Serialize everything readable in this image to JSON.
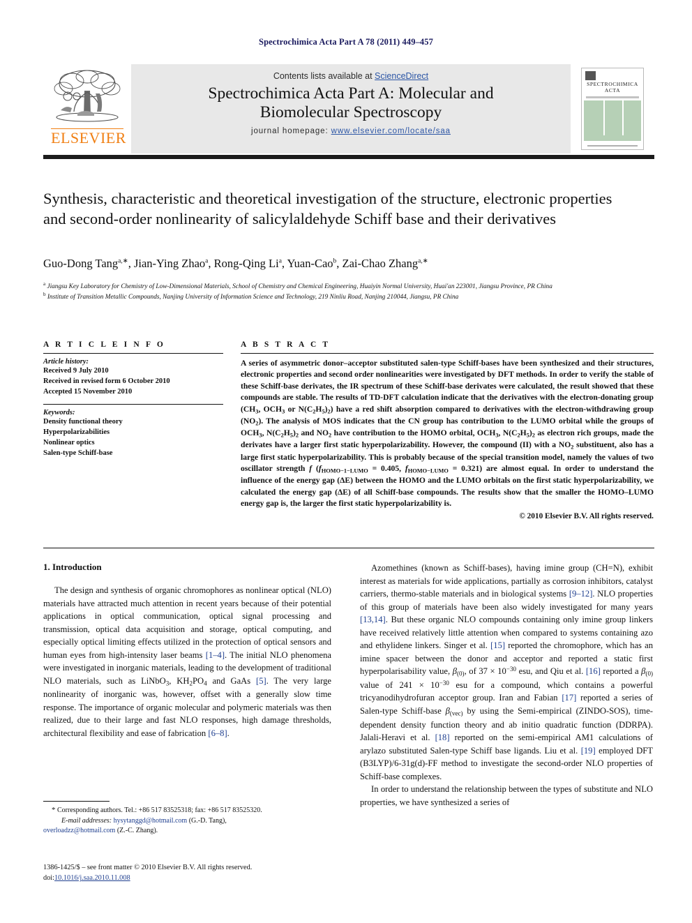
{
  "running_head": "Spectrochimica Acta Part A 78 (2011) 449–457",
  "masthead": {
    "contents_prefix": "Contents lists available at ",
    "sciencedirect": "ScienceDirect",
    "journal_name_line1": "Spectrochimica Acta Part A: Molecular and",
    "journal_name_line2": "Biomolecular Spectroscopy",
    "homepage_prefix": "journal homepage: ",
    "homepage_url": "www.elsevier.com/locate/saa",
    "publisher_logo_text": "ELSEVIER",
    "cover_title_line1": "SPECTROCHIMICA",
    "cover_title_line2": "ACTA"
  },
  "article": {
    "title": "Synthesis, characteristic and theoretical investigation of the structure, electronic properties and second-order nonlinearity of salicylaldehyde Schiff base and their derivatives",
    "authors_html": "Guo-Dong Tang<sup>a,∗</sup>, Jian-Ying Zhao<sup>a</sup>, Rong-Qing Li<sup>a</sup>, Yuan-Cao<sup>b</sup>, Zai-Chao Zhang<sup>a,∗</sup>",
    "affiliation_a": "Jiangsu Key Laboratory for Chemistry of Low-Dimensional Materials, School of Chemistry and Chemical Engineering, Huaiyin Normal University, Huai'an 223001, Jiangsu Province, PR China",
    "affiliation_b": "Institute of Transition Metallic Compounds, Nanjing University of Information Science and Technology, 219 Ninliu Road, Nanjing 210044, Jiangsu, PR China"
  },
  "article_info": {
    "heading": "A R T I C L E    I N F O",
    "history_label": "Article history:",
    "history": [
      "Received 9 July 2010",
      "Received in revised form 6 October 2010",
      "Accepted 15 November 2010"
    ],
    "keywords_label": "Keywords:",
    "keywords": [
      "Density functional theory",
      "Hyperpolarizabilities",
      "Nonlinear optics",
      "Salen-type Schiff-base"
    ]
  },
  "abstract": {
    "heading": "A B S T R A C T",
    "body_html": "A series of asymmetric donor–acceptor substituted salen-type Schiff-bases have been synthesized and their structures, electronic properties and second order nonlinearities were investigated by DFT methods. In order to verify the stable of these Schiff-base derivates, the IR spectrum of these Schiff-base derivates were calculated, the result showed that these compounds are stable. The results of TD-DFT calculation indicate that the derivatives with the electron-donating group (CH<span class=\"sub\">3</span>, OCH<span class=\"sub\">3</span> or N(C<span class=\"sub\">2</span>H<span class=\"sub\">5</span>)<span class=\"sub\">2</span>) have a red shift absorption compared to derivatives with the electron-withdrawing group (NO<span class=\"sub\">2</span>). The analysis of MOS indicates that the CN group has contribution to the LUMO orbital while the groups of OCH<span class=\"sub\">3</span>, N(C<span class=\"sub\">2</span>H<span class=\"sub\">5</span>)<span class=\"sub\">2</span> and NO<span class=\"sub\">2</span> have contribution to the HOMO orbital, OCH<span class=\"sub\">3</span>, N(C<span class=\"sub\">2</span>H<span class=\"sub\">5</span>)<span class=\"sub\">2</span> as electron rich groups, made the derivates have a larger first static hyperpolarizability. However, the compound (II) with a NO<span class=\"sub\">2</span> substituent, also has a large first static hyperpolarizability. This is probably because of the special transition model, namely the values of two oscillator strength <span class=\"ital\">f</span> (<span class=\"ital\">f</span><span class=\"sub\">HOMO−1−LUMO</span> = 0.405, <span class=\"ital\">f</span><span class=\"sub\">HOMO−LUMO</span> = 0.321) are almost equal. In order to understand the influence of the energy gap (ΔE) between the HOMO and the LUMO orbitals on the first static hyperpolarizability, we calculated the energy gap (ΔE) of all Schiff-base compounds. The results show that the smaller the HOMO–LUMO energy gap is, the larger the first static hyperpolarizability is.",
    "copyright": "© 2010 Elsevier B.V. All rights reserved."
  },
  "introduction": {
    "heading": "1.  Introduction",
    "left_paragraph_1_html": "The design and synthesis of organic chromophores as nonlinear optical (NLO) materials have attracted much attention in recent years because of their potential applications in optical communication, optical signal processing and transmission, optical data acquisition and storage, optical computing, and especially optical limiting effects utilized in the protection of optical sensors and human eyes from high-intensity laser beams <span class=\"ref\">[1–4]</span>. The initial NLO phenomena were investigated in inorganic materials, leading to the development of traditional NLO materials, such as LiNbO<span class=\"sub\">3</span>, KH<span class=\"sub\">2</span>PO<span class=\"sub\">4</span> and GaAs <span class=\"ref\">[5]</span>. The very large nonlinearity of inorganic was, however, offset with a generally slow time response. The importance of organic molecular and polymeric materials was then realized, due to their large and fast NLO responses, high damage thresholds, architectural flexibility and ease of fabrication <span class=\"ref\">[6–8]</span>.",
    "right_paragraph_1_html": "Azomethines (known as Schiff-bases), having imine group (CH&#61;N), exhibit interest as materials for wide applications, partially as corrosion inhibitors, catalyst carriers, thermo-stable materials and in biological systems <span class=\"ref\">[9–12]</span>. NLO properties of this group of materials have been also widely investigated for many years <span class=\"ref\">[13,14]</span>. But these organic NLO compounds containing only imine group linkers have received relatively little attention when compared to systems containing azo and ethylidene linkers. Singer et al. <span class=\"ref\">[15]</span> reported the chromophore, which has an imine spacer between the donor and acceptor and reported a static first hyperpolarisability value, <span class=\"ital\">β</span><span class=\"sub\">(0)</span>, of 37 × 10<span class=\"sup\">−30</span> esu, and Qiu et al. <span class=\"ref\">[16]</span> reported a <span class=\"ital\">β</span><span class=\"sub\">(0)</span> value of 241 × 10<span class=\"sup\">−30</span> esu for a compound, which contains a powerful tricyanodihydrofuran acceptor group. Iran and Fabian <span class=\"ref\">[17]</span> reported a series of Salen-type Schiff-base <span class=\"ital\">β</span><span class=\"sub\">(vec)</span> by using the Semi-empirical (ZINDO-SOS), time-dependent density function theory and ab initio quadratic function (DDRPA). Jalali-Heravi et al. <span class=\"ref\">[18]</span> reported on the semi-empirical AM1 calculations of arylazo substituted Salen-type Schiff base ligands. Liu et al. <span class=\"ref\">[19]</span> employed DFT (B3LYP)/6-31g(d)-FF method to investigate the second-order NLO properties of Schiff-base complexes.",
    "right_paragraph_2_html": "In order to understand the relationship between the types of substitute and NLO properties, we have synthesized a series of"
  },
  "footnotes": {
    "corresponding_html": "<span style=\"font-size:11px\">*</span> Corresponding authors. Tel.: +86 517 83525318; fax: +86 517 83525320.",
    "email_html": "<span class=\"ital\">E-mail addresses:</span> <span class=\"mail\">hysytanggd@hotmail.com</span> (G.-D. Tang),",
    "email_html2": "<span class=\"mail\">overloadzz@hotmail.com</span> (Z.-C. Zhang)."
  },
  "imprint": {
    "line1": "1386-1425/$ – see front matter © 2010 Elsevier B.V. All rights reserved.",
    "doi_prefix": "doi:",
    "doi_value": "10.1016/j.saa.2010.11.008"
  },
  "colors": {
    "running_head": "#1a1a5e",
    "link": "#2b55a5",
    "reference": "#1f3f8f",
    "elsevier_orange": "#f07f13",
    "masthead_band": "#e8e8e8",
    "cover_green": "#b6d0b6"
  }
}
